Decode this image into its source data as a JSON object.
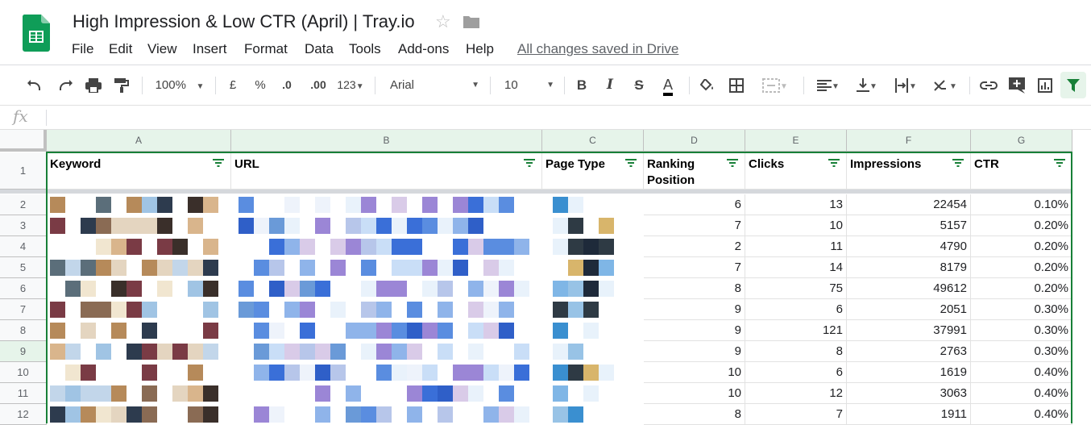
{
  "doc": {
    "title": "High Impression & Low CTR (April) | Tray.io",
    "save_status": "All changes saved in Drive"
  },
  "menu": [
    "File",
    "Edit",
    "View",
    "Insert",
    "Format",
    "Data",
    "Tools",
    "Add-ons",
    "Help"
  ],
  "toolbar": {
    "zoom": "100%",
    "currency": "£",
    "percent": "%",
    "dec_decrease": ".0",
    "dec_increase": ".00",
    "more_formats": "123",
    "font": "Arial",
    "font_size": "10",
    "bold": "B",
    "italic": "I",
    "strike": "S",
    "text_color": "A"
  },
  "formula_bar": {
    "fx": "fx",
    "value": ""
  },
  "columns": [
    "A",
    "B",
    "C",
    "D",
    "E",
    "F",
    "G"
  ],
  "headers": [
    "Keyword",
    "URL",
    "Page Type",
    "Ranking Position",
    "Clicks",
    "Impressions",
    "CTR"
  ],
  "rows": [
    {
      "n": "2",
      "rank": "6",
      "clicks": "13",
      "impr": "22454",
      "ctr": "0.10%"
    },
    {
      "n": "3",
      "rank": "7",
      "clicks": "10",
      "impr": "5157",
      "ctr": "0.20%"
    },
    {
      "n": "4",
      "rank": "2",
      "clicks": "11",
      "impr": "4790",
      "ctr": "0.20%"
    },
    {
      "n": "5",
      "rank": "7",
      "clicks": "14",
      "impr": "8179",
      "ctr": "0.20%"
    },
    {
      "n": "6",
      "rank": "8",
      "clicks": "75",
      "impr": "49612",
      "ctr": "0.20%"
    },
    {
      "n": "7",
      "rank": "9",
      "clicks": "6",
      "impr": "2051",
      "ctr": "0.30%"
    },
    {
      "n": "8",
      "rank": "9",
      "clicks": "121",
      "impr": "37991",
      "ctr": "0.30%"
    },
    {
      "n": "9",
      "rank": "9",
      "clicks": "8",
      "impr": "2763",
      "ctr": "0.30%"
    },
    {
      "n": "10",
      "rank": "10",
      "clicks": "6",
      "impr": "1619",
      "ctr": "0.40%"
    },
    {
      "n": "11",
      "rank": "10",
      "clicks": "12",
      "impr": "3063",
      "ctr": "0.40%"
    },
    {
      "n": "12",
      "rank": "8",
      "clicks": "7",
      "impr": "1911",
      "ctr": "0.40%"
    }
  ],
  "header_row_number": "1",
  "colors": {
    "accent_green": "#188038",
    "header_green": "#e6f4ea"
  }
}
